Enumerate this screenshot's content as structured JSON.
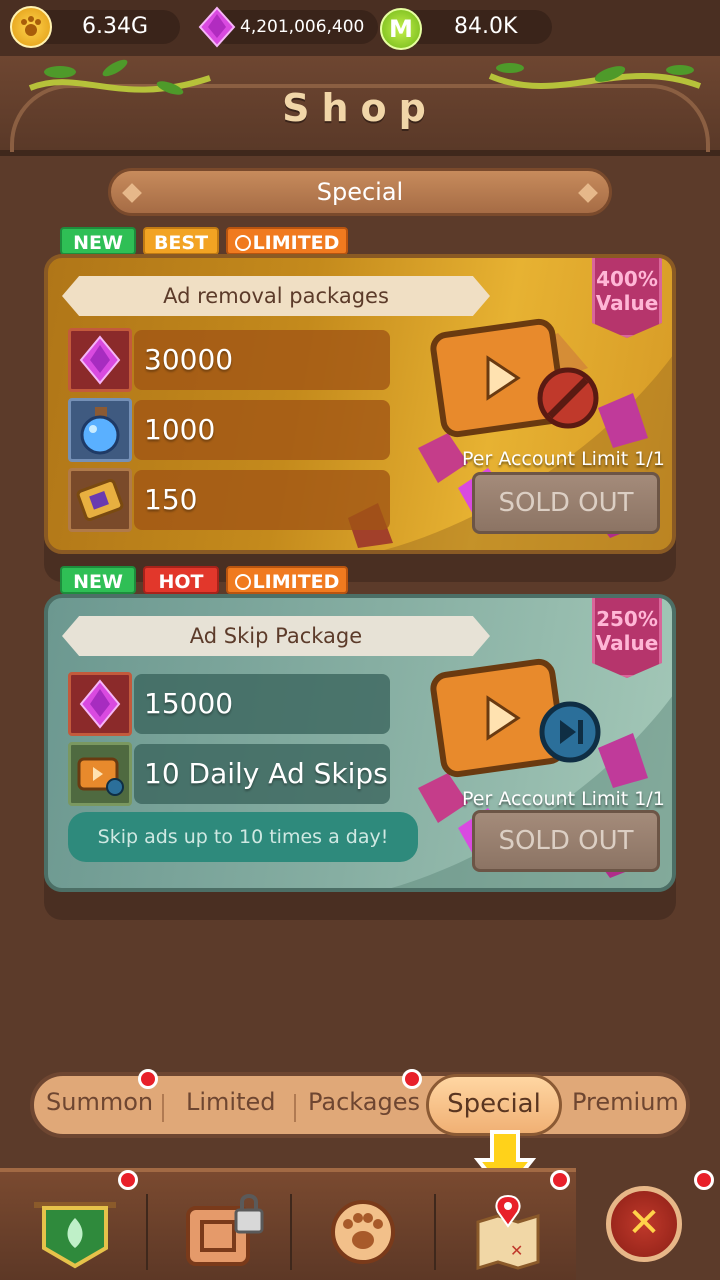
{
  "currencies": {
    "gold": "6.34G",
    "gems": "4,201,006,400",
    "mileage": "84.0K"
  },
  "header": {
    "title": "Shop"
  },
  "section": {
    "title": "Special"
  },
  "packages": [
    {
      "tags": [
        "NEW",
        "BEST",
        "LIMITED"
      ],
      "name": "Ad removal packages",
      "value_percent": "400%",
      "value_label": "Value",
      "items": [
        {
          "icon": "gem-icon",
          "amount": "30000"
        },
        {
          "icon": "potion-icon",
          "amount": "1000"
        },
        {
          "icon": "ticket-icon",
          "amount": "150"
        }
      ],
      "limit": "Per Account Limit 1/1",
      "button": "SOLD OUT",
      "overlay_icon": "no-sign-icon"
    },
    {
      "tags": [
        "NEW",
        "HOT",
        "LIMITED"
      ],
      "name": "Ad Skip Package",
      "value_percent": "250%",
      "value_label": "Value",
      "items": [
        {
          "icon": "gem-icon",
          "amount": "15000"
        },
        {
          "icon": "video-skip-icon",
          "amount": "10 Daily Ad Skips"
        }
      ],
      "note": "Skip ads up to 10 times a day!",
      "limit": "Per Account Limit 1/1",
      "button": "SOLD OUT",
      "overlay_icon": "skip-icon"
    }
  ],
  "tabs": [
    "Summon",
    "Limited",
    "Packages",
    "Special",
    "Premium"
  ],
  "active_tab": "Special",
  "bottom_nav": [
    {
      "icon": "guild-banner-icon"
    },
    {
      "icon": "scroll-locked-icon"
    },
    {
      "icon": "paw-icon"
    },
    {
      "icon": "treasure-map-icon"
    }
  ],
  "close": {
    "icon": "close-icon",
    "glyph": "✕"
  },
  "colors": {
    "background": "#5c3b2a",
    "notification_dot": "#e8202a",
    "tag_new": "#2fbf55",
    "tag_best": "#f2a323",
    "tag_hot": "#e2372b",
    "tag_limited": "#f07a1f",
    "value_badge": "#b6356c"
  }
}
